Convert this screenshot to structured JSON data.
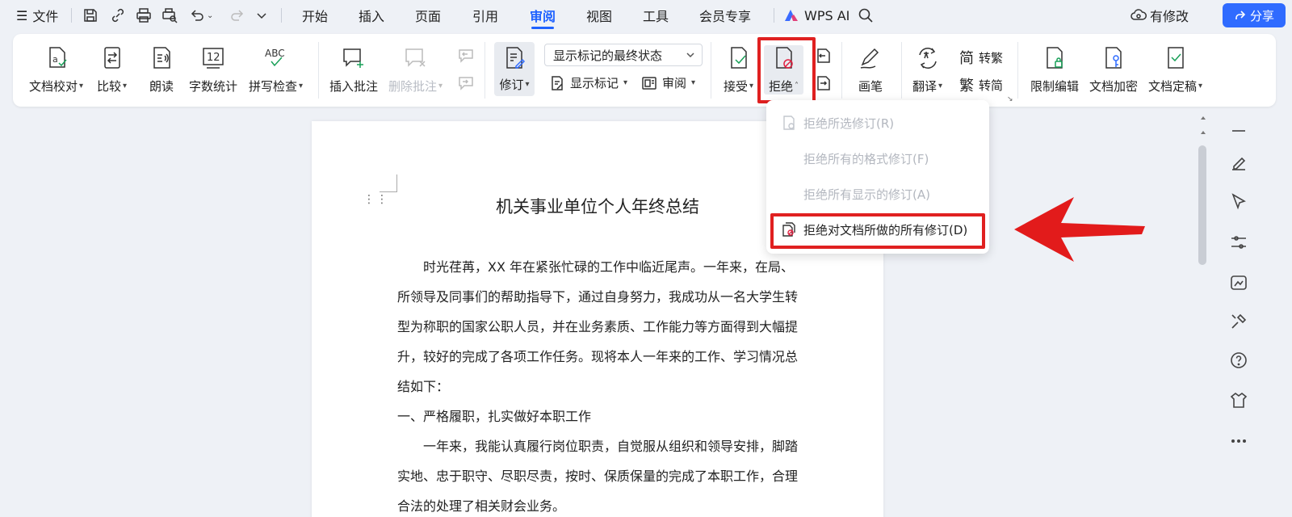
{
  "menubar": {
    "file_label": "文件",
    "tabs": [
      "开始",
      "插入",
      "页面",
      "引用",
      "审阅",
      "视图",
      "工具",
      "会员专享"
    ],
    "active_tab": "审阅",
    "wps_ai": "WPS AI",
    "modify_label": "有修改",
    "share_label": "分享"
  },
  "ribbon": {
    "proofread": "文档校对",
    "compare": "比较",
    "read_aloud": "朗读",
    "word_count": "字数统计",
    "spell_check": "拼写检查",
    "insert_comment": "插入批注",
    "delete_comment": "删除批注",
    "track_changes": "修订",
    "markup_state": "显示标记的最终状态",
    "show_markup": "显示标记",
    "review": "审阅",
    "accept": "接受",
    "reject": "拒绝",
    "pen": "画笔",
    "translate": "翻译",
    "to_traditional": "转繁",
    "to_simplified": "转简",
    "restrict_edit": "限制编辑",
    "encrypt": "文档加密",
    "finalize": "文档定稿",
    "spell_icon_text": "ABC",
    "count_icon_text": "12"
  },
  "reject_menu": {
    "items": [
      {
        "label": "拒绝所选修订(R)",
        "enabled": false
      },
      {
        "label": "拒绝所有的格式修订(F)",
        "enabled": false
      },
      {
        "label": "拒绝所有显示的修订(A)",
        "enabled": false
      },
      {
        "label": "拒绝对文档所做的所有修订(D)",
        "enabled": true
      }
    ]
  },
  "document": {
    "title": "机关事业单位个人年终总结",
    "paragraphs": [
      "　　时光荏苒，XX 年在紧张忙碌的工作中临近尾声。一年来，在局、所领导及同事们的帮助指导下，通过自身努力，我成功从一名大学生转型为称职的国家公职人员，并在业务素质、工作能力等方面得到大幅提升，较好的完成了各项工作任务。现将本人一年来的工作、学习情况总结如下：",
      "一、严格履职，扎实做好本职工作",
      "　　一年来，我能认真履行岗位职责，自觉服从组织和领导安排，脚踏实地、忠于职守、尽职尽责，按时、保质保量的完成了本职工作，合理合法的处理了相关财会业务。"
    ]
  },
  "colors": {
    "accent": "#1f62ff",
    "highlight": "#e02020",
    "share_bg": "#2f6bff"
  }
}
